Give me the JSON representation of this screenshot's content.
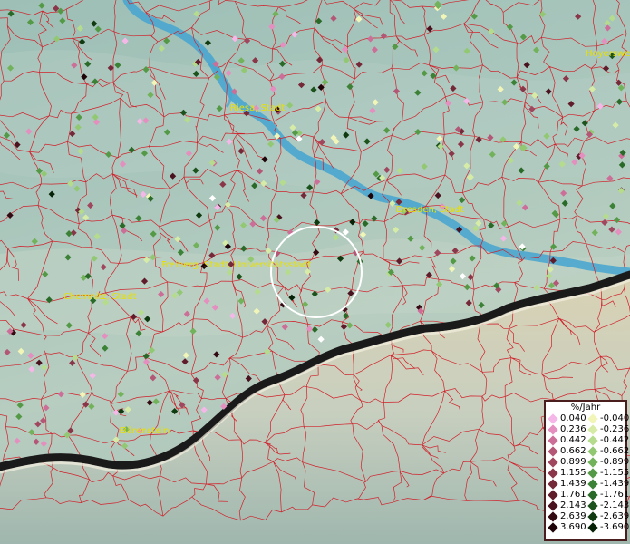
{
  "map": {
    "cities": [
      {
        "name": "Riesa, Stadt"
      },
      {
        "name": "Dresden, Stadt"
      },
      {
        "name": "Freiberg, Stadt, Universitätsstadt"
      },
      {
        "name": "Chemnitz, Stadt"
      },
      {
        "name": "Bärenstein"
      },
      {
        "name": "Hoyerswe"
      }
    ],
    "colors": {
      "river": "#4aa6cf",
      "boundary": "#d0202a",
      "border": "#1a1a1a",
      "label": "#e8e000",
      "selection_ring": "#ffffff"
    }
  },
  "legend": {
    "title": "%/Jahr",
    "positive": [
      {
        "label": "0.040",
        "color": "#f5b7e8"
      },
      {
        "label": "0.236",
        "color": "#e48fbf"
      },
      {
        "label": "0.442",
        "color": "#cc6e98"
      },
      {
        "label": "0.662",
        "color": "#b45676"
      },
      {
        "label": "0.899",
        "color": "#a0465e"
      },
      {
        "label": "1.155",
        "color": "#8a3648"
      },
      {
        "label": "1.439",
        "color": "#752838"
      },
      {
        "label": "1.761",
        "color": "#601c2a"
      },
      {
        "label": "2.143",
        "color": "#4a121e"
      },
      {
        "label": "2.639",
        "color": "#340a12"
      },
      {
        "label": "3.690",
        "color": "#1e0408"
      }
    ],
    "negative": [
      {
        "label": "-0.040",
        "color": "#f2f5b8"
      },
      {
        "label": "-0.236",
        "color": "#d6eca6"
      },
      {
        "label": "-0.442",
        "color": "#b5dc8c"
      },
      {
        "label": "-0.662",
        "color": "#92c872"
      },
      {
        "label": "-0.899",
        "color": "#72b25a"
      },
      {
        "label": "-1.155",
        "color": "#549a46"
      },
      {
        "label": "-1.439",
        "color": "#3c8236"
      },
      {
        "label": "-1.761",
        "color": "#2a6a28"
      },
      {
        "label": "-2.143",
        "color": "#1c521c"
      },
      {
        "label": "-2.639",
        "color": "#103a10"
      },
      {
        "label": "-3.690",
        "color": "#062206"
      }
    ]
  }
}
